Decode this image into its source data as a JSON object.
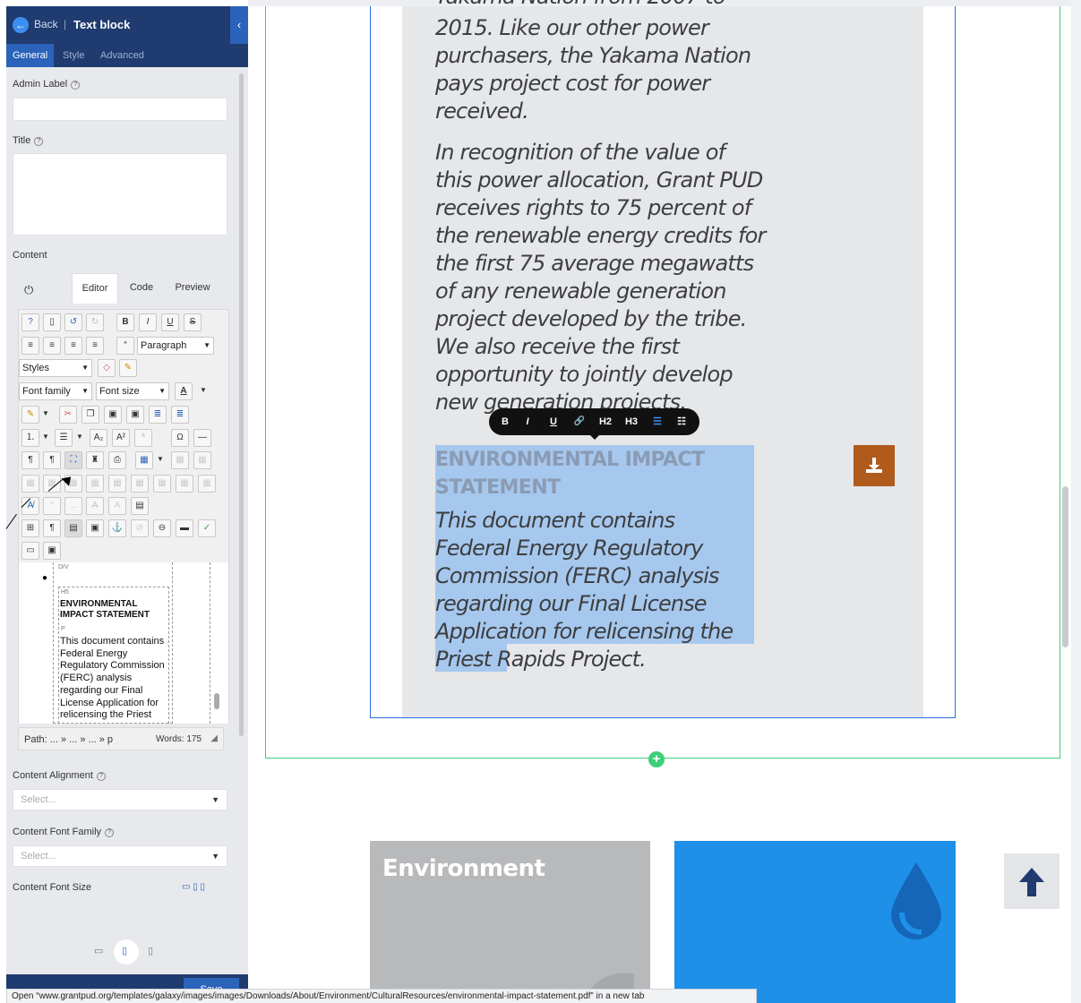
{
  "panel": {
    "back_label": "Back",
    "separator": "|",
    "title": "Text block",
    "tabs": [
      "General",
      "Style",
      "Advanced"
    ],
    "admin_label": "Admin Label",
    "title_label": "Title",
    "content_label": "Content",
    "editor_tabs": [
      "Editor",
      "Code",
      "Preview"
    ],
    "paragraph_select": "Paragraph",
    "styles_select": "Styles",
    "font_family_select": "Font family",
    "font_size_select": "Font size",
    "path_text": "Path: ... » ... » ... » p",
    "words_text": "Words: 175",
    "content_alignment_label": "Content Alignment",
    "content_alignment_placeholder": "Select...",
    "content_font_family_label": "Content Font Family",
    "content_font_family_placeholder": "Select...",
    "content_font_size_label": "Content Font Size",
    "save_label": "Save"
  },
  "doc_preview": {
    "div_tag": "DIV",
    "h5_tag": "H5",
    "heading": "ENVIRONMENTAL IMPACT STATEMENT",
    "p_tag": "P",
    "paragraph": "This document contains Federal Energy Regulatory Commission (FERC) analysis regarding our Final License Application for relicensing the Priest"
  },
  "content": {
    "top_clipped": "Yakama Nation from 2007 to",
    "para1": "2015. Like our other power purchasers, the Yakama Nation pays project cost for power received.",
    "para2": "In recognition of the value of this power allocation, Grant PUD receives rights to 75 percent of the renewable energy credits for the first 75 average megawatts of any renewable generation project developed by the tribe. We also receive the first opportunity to jointly develop new generation projects.",
    "section_heading": "ENVIRONMENTAL IMPACT STATEMENT",
    "section_text": "This document contains Federal Energy Regulatory Commission (FERC) analysis regarding our Final License Application for relicensing the Priest Rapids Project."
  },
  "float_toolbar": [
    "B",
    "I",
    "U",
    "🔗",
    "H2",
    "H3",
    "☰",
    "☷"
  ],
  "cards": {
    "environment_title": "Environment"
  },
  "status_bar": "Open “www.grantpud.org/templates/galaxy/images/images/Downloads/About/Environment/CulturalResources/environmental-impact-statement.pdf” in a new tab",
  "colors": {
    "panel_header": "#1f3b70",
    "accent_blue": "#2a63b9",
    "selection": "#a6c8ee",
    "download_button": "#b05a1c",
    "row_outline": "#3ed079"
  }
}
